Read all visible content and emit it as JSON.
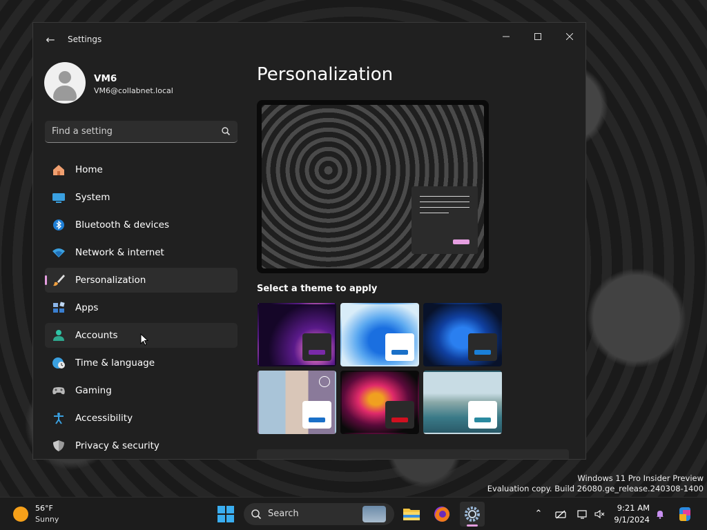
{
  "window": {
    "title": "Settings",
    "back_icon": "arrow-left-icon",
    "controls": [
      "minimize-icon",
      "maximize-icon",
      "close-icon"
    ]
  },
  "profile": {
    "name": "VM6",
    "email": "VM6@collabnet.local"
  },
  "search": {
    "placeholder": "Find a setting"
  },
  "nav": {
    "items": [
      {
        "label": "Home",
        "icon": "home-icon"
      },
      {
        "label": "System",
        "icon": "monitor-icon"
      },
      {
        "label": "Bluetooth & devices",
        "icon": "bluetooth-icon"
      },
      {
        "label": "Network & internet",
        "icon": "wifi-icon"
      },
      {
        "label": "Personalization",
        "icon": "brush-icon",
        "selected": true
      },
      {
        "label": "Apps",
        "icon": "apps-icon"
      },
      {
        "label": "Accounts",
        "icon": "person-icon"
      },
      {
        "label": "Time & language",
        "icon": "globe-clock-icon"
      },
      {
        "label": "Gaming",
        "icon": "gamepad-icon"
      },
      {
        "label": "Accessibility",
        "icon": "accessibility-icon"
      },
      {
        "label": "Privacy & security",
        "icon": "shield-icon"
      }
    ]
  },
  "main": {
    "title": "Personalization",
    "theme_heading": "Select a theme to apply",
    "accent_color": "#e59ee0"
  },
  "desktop": {
    "watermark_line1": "Windows 11 Pro Insider Preview",
    "watermark_line2": "Evaluation copy. Build 26080.ge_release.240308-1400"
  },
  "taskbar": {
    "weather_temp": "56°F",
    "weather_condition": "Sunny",
    "search_label": "Search",
    "time": "9:21 AM",
    "date": "9/1/2024"
  }
}
